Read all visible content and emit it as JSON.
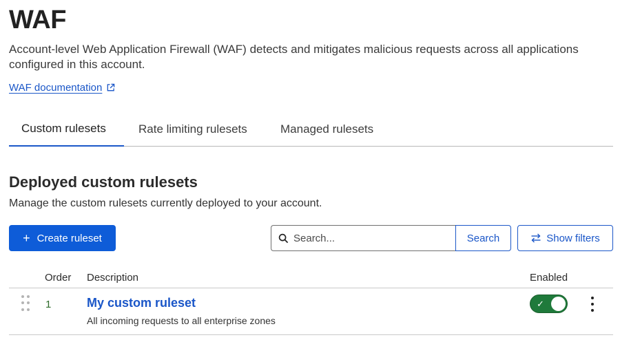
{
  "page": {
    "title": "WAF",
    "description": "Account-level Web Application Firewall (WAF) detects and mitigates malicious requests across all applications configured in this account.",
    "doc_link": "WAF documentation"
  },
  "tabs": [
    {
      "label": "Custom rulesets",
      "active": true
    },
    {
      "label": "Rate limiting rulesets",
      "active": false
    },
    {
      "label": "Managed rulesets",
      "active": false
    }
  ],
  "section": {
    "title": "Deployed custom rulesets",
    "description": "Manage the custom rulesets currently deployed to your account."
  },
  "toolbar": {
    "create_label": "Create ruleset",
    "search_placeholder": "Search...",
    "search_button": "Search",
    "filters_label": "Show filters"
  },
  "table": {
    "columns": {
      "order": "Order",
      "description": "Description",
      "enabled": "Enabled"
    },
    "rows": [
      {
        "order": "1",
        "name": "My custom ruleset",
        "detail": "All incoming requests to all enterprise zones",
        "enabled": true
      }
    ]
  },
  "colors": {
    "accent": "#1a56c8",
    "primary_button": "#0e5cd8",
    "toggle_on": "#1f7a3b"
  }
}
